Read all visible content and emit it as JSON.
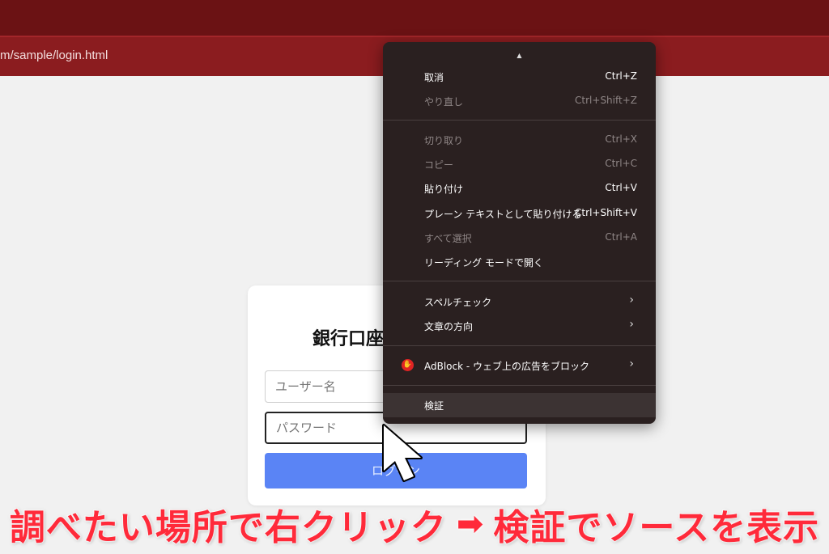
{
  "browser": {
    "url": "m/sample/login.html"
  },
  "login": {
    "title": "銀行口座",
    "username_placeholder": "ユーザー名",
    "password_placeholder": "パスワード",
    "button_label": "ログイン"
  },
  "context_menu": {
    "items": [
      {
        "label": "取消",
        "shortcut": "Ctrl+Z",
        "disabled": false
      },
      {
        "label": "やり直し",
        "shortcut": "Ctrl+Shift+Z",
        "disabled": true
      },
      {
        "label": "切り取り",
        "shortcut": "Ctrl+X",
        "disabled": true
      },
      {
        "label": "コピー",
        "shortcut": "Ctrl+C",
        "disabled": true
      },
      {
        "label": "貼り付け",
        "shortcut": "Ctrl+V",
        "disabled": false
      },
      {
        "label": "プレーン テキストとして貼り付ける",
        "shortcut": "Ctrl+Shift+V",
        "disabled": false
      },
      {
        "label": "すべて選択",
        "shortcut": "Ctrl+A",
        "disabled": true
      },
      {
        "label": "リーディング モードで開く",
        "shortcut": "",
        "disabled": false
      },
      {
        "label": "スペルチェック",
        "submenu": true
      },
      {
        "label": "文章の方向",
        "submenu": true
      },
      {
        "label": "AdBlock - ウェブ上の広告をブロック",
        "submenu": true,
        "icon": "adblock-hand-icon"
      },
      {
        "label": "検証",
        "highlighted": true
      }
    ]
  },
  "banner": {
    "left_text": "調べたい場所で右クリック",
    "right_text": "検証でソースを表示",
    "arrow_icon": "right-arrow-icon"
  },
  "colors": {
    "titlebar": "#6b1214",
    "addressbar": "#8b1c1f",
    "menu_bg": "#2a2020",
    "login_button": "#5a84f5",
    "banner_text": "#ff2a3a"
  }
}
